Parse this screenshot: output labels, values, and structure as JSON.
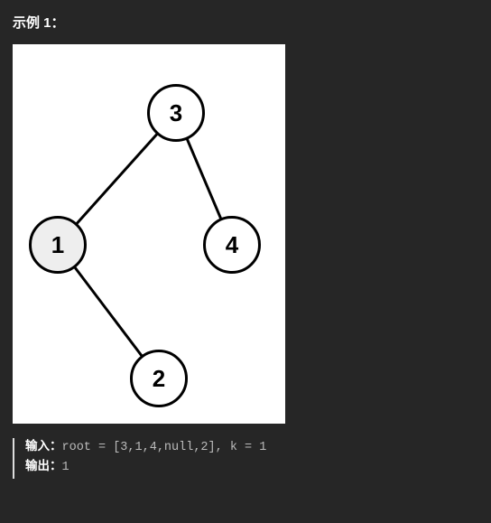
{
  "example": {
    "heading": "示例 1：",
    "input_label": "输入：",
    "output_label": "输出：",
    "input_value": "root = [3,1,4,null,2], k = 1",
    "output_value": "1"
  },
  "chart_data": {
    "type": "tree",
    "title": "",
    "nodes": [
      {
        "id": "3",
        "value": 3,
        "highlighted": false
      },
      {
        "id": "1",
        "value": 1,
        "highlighted": true
      },
      {
        "id": "4",
        "value": 4,
        "highlighted": false
      },
      {
        "id": "2",
        "value": 2,
        "highlighted": false
      }
    ],
    "edges": [
      {
        "from": "3",
        "to": "1"
      },
      {
        "from": "3",
        "to": "4"
      },
      {
        "from": "1",
        "to": "2"
      }
    ],
    "tree_structure": {
      "value": 3,
      "left": {
        "value": 1,
        "left": null,
        "right": {
          "value": 2,
          "left": null,
          "right": null
        }
      },
      "right": {
        "value": 4,
        "left": null,
        "right": null
      }
    }
  }
}
